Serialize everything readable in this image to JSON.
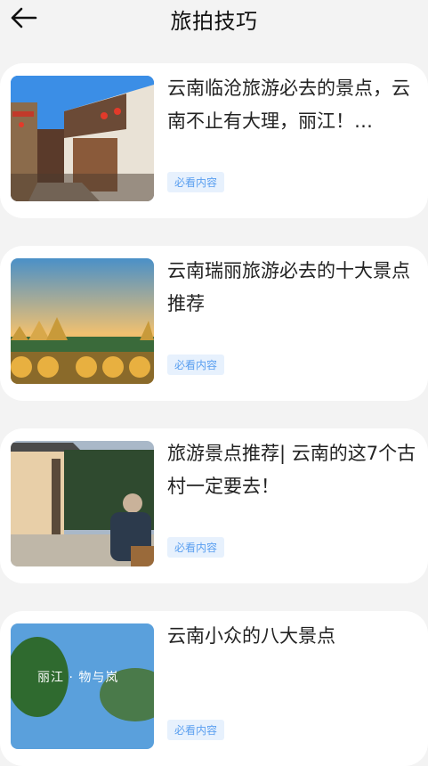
{
  "header": {
    "title": "旅拍技巧",
    "back_icon": "back-arrow-icon"
  },
  "articles": [
    {
      "title": "云南临沧旅游必去的景点，云南不止有大理，丽江！…",
      "tag": "必看内容"
    },
    {
      "title": "云南瑞丽旅游必去的十大景点推荐",
      "tag": "必看内容"
    },
    {
      "title": "旅游景点推荐| 云南的这7个古村一定要去！",
      "tag": "必看内容"
    },
    {
      "title": "云南小众的八大景点",
      "tag": "必看内容",
      "thumb_caption": "丽江 · 物与岚"
    }
  ],
  "colors": {
    "background": "#f3f3f3",
    "card": "#ffffff",
    "tag_text": "#5a9ff0",
    "tag_bg": "#e7f1fd"
  }
}
